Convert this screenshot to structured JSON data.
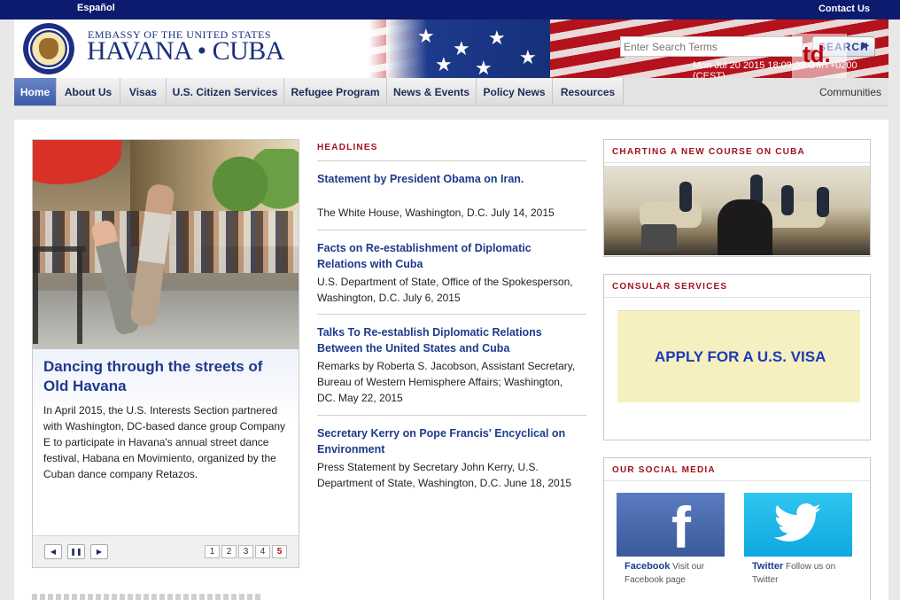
{
  "topbar": {
    "language": "Español",
    "contact": "Contact Us"
  },
  "header": {
    "line1": "EMBASSY OF THE UNITED STATES",
    "line2": "HAVANA • CUBA",
    "search_placeholder": "Enter Search Terms",
    "search_button": "SEARCH",
    "datetime": "Mon Jul 20 2015 18:09:09 GMT+0200 (CEST)",
    "watermark": "td."
  },
  "nav": {
    "items": [
      {
        "label": "Home"
      },
      {
        "label": "About Us"
      },
      {
        "label": "Visas"
      },
      {
        "label": "U.S. Citizen Services"
      },
      {
        "label": "Refugee Program"
      },
      {
        "label": "News & Events"
      },
      {
        "label": "Policy News"
      },
      {
        "label": "Resources"
      }
    ],
    "communities": "Communities"
  },
  "feature": {
    "title": "Dancing through the streets of Old Havana",
    "text": "In April 2015, the U.S. Interests Section partnered with Washington, DC-based dance group Company E to participate in Havana's annual street dance festival, Habana en Movimiento, organized by the Cuban dance company Retazos.",
    "controls": {
      "prev": "◀",
      "pause": "❚❚",
      "next": "▶"
    },
    "pages": [
      "1",
      "2",
      "3",
      "4",
      "5"
    ]
  },
  "headlines": {
    "label": "HEADLINES",
    "items": [
      {
        "title": "Statement by President Obama on Iran.",
        "desc": "The White House, Washington, D.C. July 14, 2015"
      },
      {
        "title": "Facts on Re-establishment of Diplomatic Relations with Cuba",
        "desc": "U.S. Department of State, Office of the Spokesperson, Washington, D.C. July 6, 2015"
      },
      {
        "title": "Talks To Re-establish Diplomatic Relations Between the United States and Cuba",
        "desc": "Remarks by Roberta S. Jacobson, Assistant Secretary, Bureau of Western Hemisphere Affairs; Washington, DC. May 22, 2015"
      },
      {
        "title": "Secretary Kerry on Pope Francis' Encyclical on Environment",
        "desc": "Press Statement by Secretary John Kerry, U.S. Department of State, Washington, D.C. June 18, 2015"
      }
    ]
  },
  "right": {
    "charting_title": "CHARTING A NEW COURSE ON CUBA",
    "consular_title": "CONSULAR SERVICES",
    "visa_link": "APPLY FOR A U.S. VISA",
    "social_title": "OUR SOCIAL MEDIA",
    "facebook": {
      "name": "Facebook",
      "desc": "Visit our Facebook page"
    },
    "twitter": {
      "name": "Twitter",
      "desc": "Follow us on Twitter"
    }
  },
  "colors": {
    "navy": "#0c1b6d",
    "accent_red": "#a3111c",
    "link_blue": "#1e3a8c"
  }
}
